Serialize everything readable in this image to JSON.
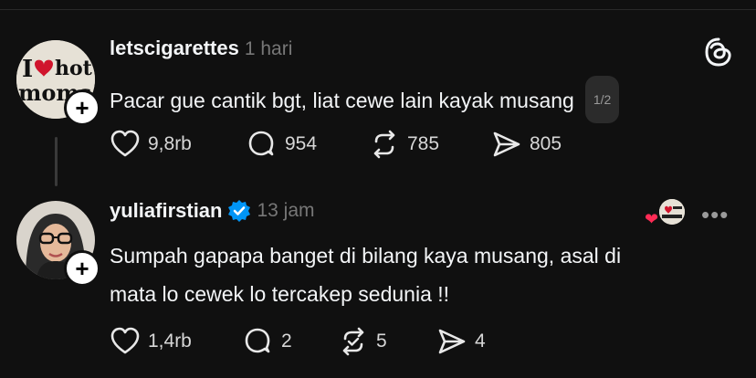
{
  "posts": [
    {
      "username": "letscigarettes",
      "time": "1 hari",
      "text": "Pacar gue cantik bgt, liat cewe lain kayak musang",
      "page_badge": "1/2",
      "avatar_text": "I ❤ hot moms",
      "likes": "9,8rb",
      "replies": "954",
      "reposts": "785",
      "shares": "805"
    },
    {
      "username": "yuliafirstian",
      "verified": true,
      "time": "13 jam",
      "text_line1": "Sumpah gapapa banget di bilang kaya musang, asal di",
      "text_line2": "mata lo cewek lo tercakep sedunia !!",
      "likes": "1,4rb",
      "replies": "2",
      "reposts": "5",
      "shares": "4"
    }
  ],
  "icons": {
    "threads_logo": "threads-logo-icon",
    "like": "heart-icon",
    "reply": "speech-bubble-icon",
    "repost": "repost-icon",
    "share": "send-icon",
    "more": "more-horizontal-icon"
  },
  "colors": {
    "background": "#101010",
    "text": "#f3f5f7",
    "muted": "#777777",
    "verified": "#0095f6",
    "liked_heart": "#ff2b55"
  },
  "more_label": "•••",
  "plus": "+"
}
